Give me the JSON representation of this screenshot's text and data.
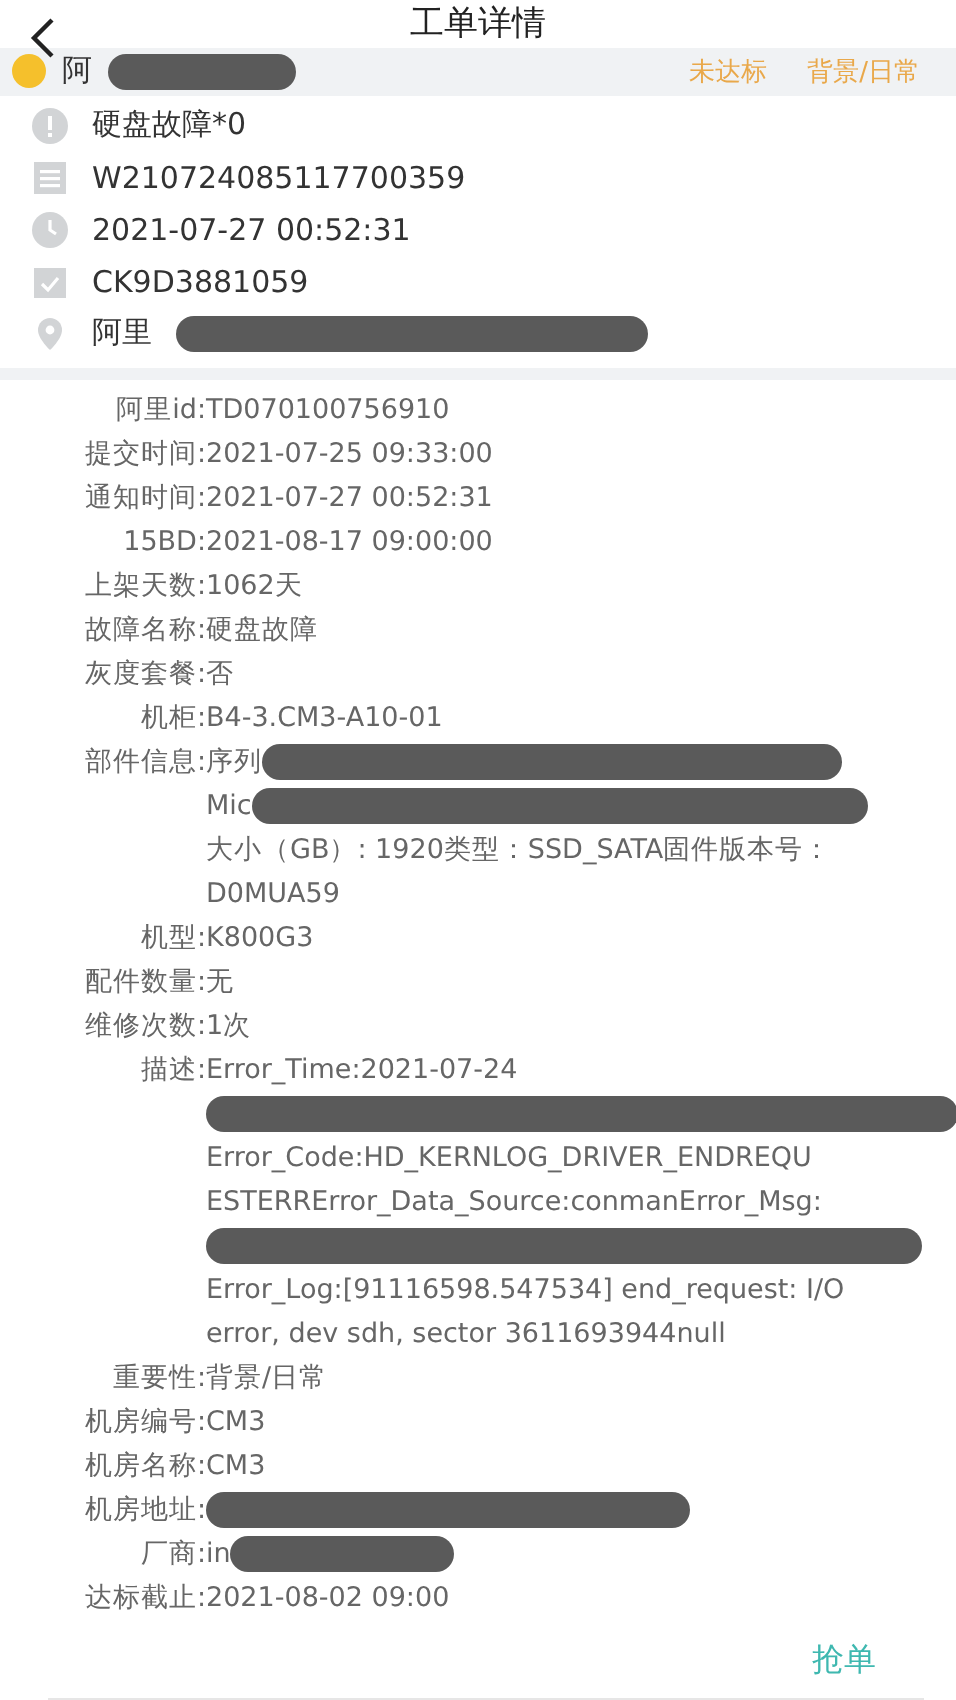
{
  "header": {
    "title": "工单详情"
  },
  "summary": {
    "name": [
      {
        "kind": "text",
        "text": "阿"
      },
      {
        "kind": "redacted"
      }
    ],
    "tags": [
      "未达标",
      "背景/日常"
    ]
  },
  "info": [
    {
      "kind": "alert",
      "parts": [
        {
          "kind": "text",
          "text": "硬盘故障*0"
        }
      ]
    },
    {
      "kind": "list",
      "parts": [
        {
          "kind": "text",
          "text": "W210724085117700359"
        }
      ]
    },
    {
      "kind": "clock",
      "parts": [
        {
          "kind": "text",
          "text": "2021-07-27 00:52:31"
        }
      ]
    },
    {
      "kind": "check",
      "parts": [
        {
          "kind": "text",
          "text": "CK9D3881059"
        }
      ]
    },
    {
      "kind": "pin",
      "parts": [
        {
          "kind": "text",
          "text": "阿里"
        },
        {
          "kind": "redacted"
        }
      ]
    }
  ],
  "details": [
    {
      "label": "阿里id:",
      "lines": [
        [
          {
            "kind": "text",
            "text": "TD070100756910"
          }
        ]
      ]
    },
    {
      "label": "提交时间:",
      "lines": [
        [
          {
            "kind": "text",
            "text": "2021-07-25 09:33:00"
          }
        ]
      ]
    },
    {
      "label": "通知时间:",
      "lines": [
        [
          {
            "kind": "text",
            "text": "2021-07-27 00:52:31"
          }
        ]
      ]
    },
    {
      "label": "15BD:",
      "lines": [
        [
          {
            "kind": "text",
            "text": "2021-08-17 09:00:00"
          }
        ]
      ]
    },
    {
      "label": "上架天数:",
      "lines": [
        [
          {
            "kind": "text",
            "text": "1062天"
          }
        ]
      ]
    },
    {
      "label": "故障名称:",
      "lines": [
        [
          {
            "kind": "text",
            "text": "硬盘故障"
          }
        ]
      ]
    },
    {
      "label": "灰度套餐:",
      "lines": [
        [
          {
            "kind": "text",
            "text": "否"
          }
        ]
      ]
    },
    {
      "label": "机柜:",
      "lines": [
        [
          {
            "kind": "text",
            "text": "B4-3.CM3-A10-01"
          }
        ]
      ]
    },
    {
      "label": "部件信息:",
      "lines": [
        [
          {
            "kind": "text",
            "text": "序列"
          },
          {
            "kind": "redacted"
          }
        ],
        [
          {
            "kind": "text",
            "text": "Mic"
          },
          {
            "kind": "redacted"
          }
        ],
        [
          {
            "kind": "text",
            "text": "大小（GB）: 1920类型：SSD_SATA固件版本号："
          }
        ],
        [
          {
            "kind": "text",
            "text": "D0MUA59"
          }
        ]
      ]
    },
    {
      "label": "机型:",
      "lines": [
        [
          {
            "kind": "text",
            "text": "K800G3"
          }
        ]
      ]
    },
    {
      "label": "配件数量:",
      "lines": [
        [
          {
            "kind": "text",
            "text": "无"
          }
        ]
      ]
    },
    {
      "label": "维修次数:",
      "lines": [
        [
          {
            "kind": "text",
            "text": "1次"
          }
        ]
      ]
    },
    {
      "label": "描述:",
      "lines": [
        [
          {
            "kind": "text",
            "text": "Error_Time:2021-07-24"
          }
        ],
        [
          {
            "kind": "redacted"
          }
        ],
        [
          {
            "kind": "text",
            "text": "Error_Code:HD_KERNLOG_DRIVER_ENDREQU"
          }
        ],
        [
          {
            "kind": "text",
            "text": "ESTERRError_Data_Source:conmanError_Msg:"
          }
        ],
        [
          {
            "kind": "redacted"
          }
        ],
        [
          {
            "kind": "text",
            "text": "Error_Log:[91116598.547534] end_request: I/O"
          }
        ],
        [
          {
            "kind": "text",
            "text": "error, dev sdh, sector 3611693944null"
          }
        ]
      ]
    },
    {
      "label": "重要性:",
      "lines": [
        [
          {
            "kind": "text",
            "text": "背景/日常"
          }
        ]
      ]
    },
    {
      "label": "机房编号:",
      "lines": [
        [
          {
            "kind": "text",
            "text": "CM3"
          }
        ]
      ]
    },
    {
      "label": "机房名称:",
      "lines": [
        [
          {
            "kind": "text",
            "text": "CM3"
          }
        ]
      ]
    },
    {
      "label": "机房地址:",
      "lines": [
        [
          {
            "kind": "redacted"
          }
        ]
      ]
    },
    {
      "label": "厂商:",
      "lines": [
        [
          {
            "kind": "text",
            "text": "in"
          },
          {
            "kind": "redacted"
          }
        ]
      ]
    },
    {
      "label": "达标截止:",
      "lines": [
        [
          {
            "kind": "text",
            "text": "2021-08-02 09:00"
          }
        ]
      ]
    }
  ],
  "action": {
    "label": "抢单"
  }
}
